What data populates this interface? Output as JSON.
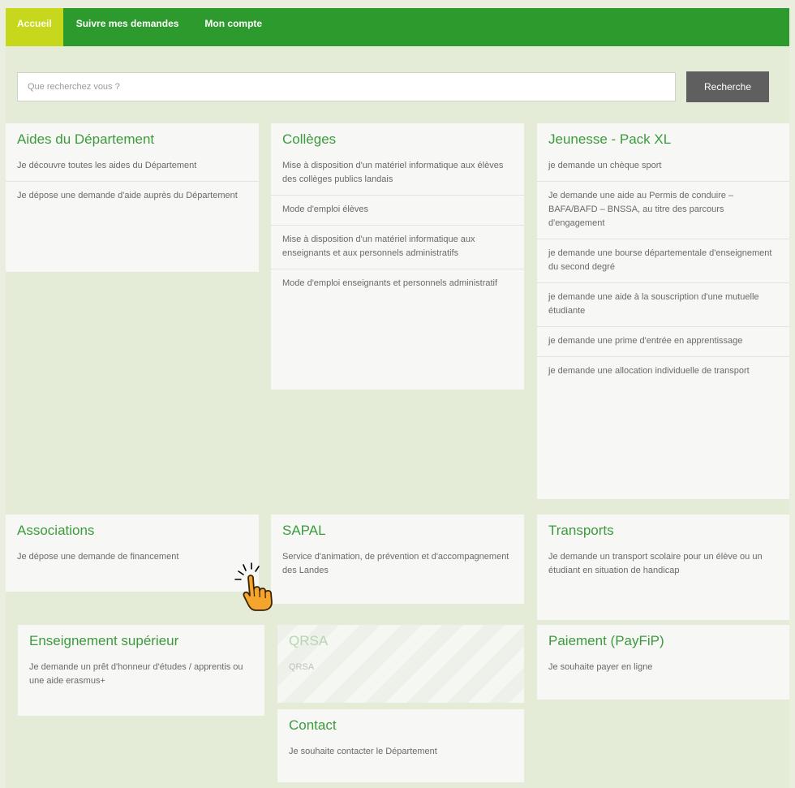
{
  "nav": {
    "home": "Accueil",
    "track": "Suivre mes demandes",
    "account": "Mon compte"
  },
  "search": {
    "placeholder": "Que recherchez vous ?",
    "button": "Recherche"
  },
  "cards": {
    "aides": {
      "title": "Aides du Département",
      "items": [
        "Je découvre toutes les aides du Département",
        "Je dépose une demande d'aide auprès du Département"
      ]
    },
    "colleges": {
      "title": "Collèges",
      "items": [
        "Mise à disposition d'un matériel informatique aux élèves des collèges publics landais",
        "Mode d'emploi élèves",
        "Mise à disposition d'un matériel informatique aux enseignants et aux personnels administratifs",
        "Mode d'emploi enseignants et personnels administratif"
      ]
    },
    "jeunesse": {
      "title": "Jeunesse - Pack XL",
      "items": [
        "je demande un chèque sport",
        "Je demande une aide au Permis de conduire – BAFA/BAFD – BNSSA, au titre des parcours d'engagement",
        "je demande une bourse départementale d'enseignement du second degré",
        "je demande une aide à la souscription d'une mutuelle étudiante",
        "je demande une prime d'entrée en apprentissage",
        "je demande une allocation individuelle de transport"
      ]
    },
    "associations": {
      "title": "Associations",
      "items": [
        "Je dépose une demande de financement"
      ]
    },
    "sapal": {
      "title": "SAPAL",
      "items": [
        "Service d'animation, de prévention et d'accompagnement des Landes"
      ]
    },
    "transports": {
      "title": "Transports",
      "items": [
        "Je demande un transport scolaire pour un élève ou un étudiant en situation de handicap"
      ]
    },
    "enseignement": {
      "title": "Enseignement supérieur",
      "items": [
        "Je demande un prêt d'honneur d'études / apprentis ou une aide erasmus+"
      ]
    },
    "qrsa": {
      "title": "QRSA",
      "items": [
        "QRSA"
      ]
    },
    "paiement": {
      "title": "Paiement (PayFiP)",
      "items": [
        "Je souhaite payer en ligne"
      ]
    },
    "contact": {
      "title": "Contact",
      "items": [
        "Je souhaite contacter le Département"
      ]
    }
  },
  "colors": {
    "nav_green": "#2d9a2d",
    "nav_active": "#c7d81c",
    "title_green": "#3c9b3c",
    "button_gray": "#5f5f5f"
  },
  "icons": {
    "cursor": "pointing-hand-icon"
  }
}
